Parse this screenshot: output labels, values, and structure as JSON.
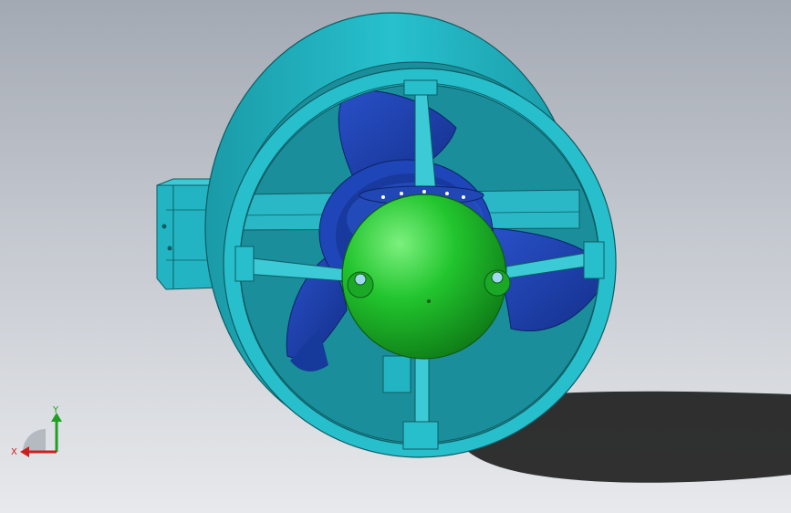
{
  "viewport": {
    "model": "ducted-thruster-assembly",
    "colors": {
      "background_top": "#a3a9b3",
      "background_bottom": "#e7e9ec",
      "duct": "#22b4c2",
      "duct_dark": "#1a8f9b",
      "propeller": "#1e3fa8",
      "hub": "#22c52e",
      "shadow": "#2a2a2a"
    }
  },
  "triad": {
    "x_label": "X",
    "y_label": "Y",
    "x_color": "#cc2020",
    "y_color": "#20a020"
  }
}
